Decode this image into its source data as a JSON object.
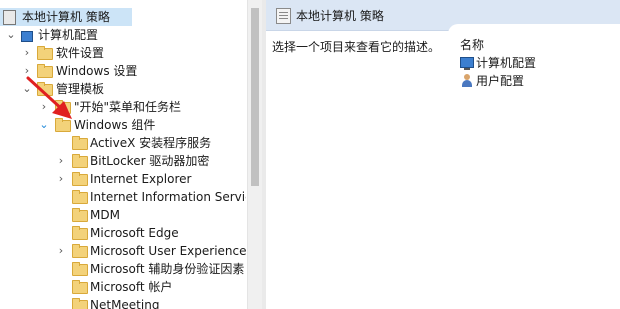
{
  "tree": {
    "root": "本地计算机 策略",
    "computer_config": "计算机配置",
    "software_settings": "软件设置",
    "windows_settings": "Windows 设置",
    "admin_templates": "管理模板",
    "start_menu": "\"开始\"菜单和任务栏",
    "windows_components": "Windows 组件",
    "children": [
      {
        "label": "ActiveX 安装程序服务",
        "expandable": false
      },
      {
        "label": "BitLocker 驱动器加密",
        "expandable": true
      },
      {
        "label": "Internet Explorer",
        "expandable": true
      },
      {
        "label": "Internet Information Services",
        "expandable": false
      },
      {
        "label": "MDM",
        "expandable": false
      },
      {
        "label": "Microsoft Edge",
        "expandable": false
      },
      {
        "label": "Microsoft User Experience Virt",
        "expandable": true
      },
      {
        "label": "Microsoft 辅助身份验证因素",
        "expandable": false
      },
      {
        "label": "Microsoft 帐户",
        "expandable": false
      },
      {
        "label": "NetMeeting",
        "expandable": false
      }
    ]
  },
  "right": {
    "header_title": "本地计算机 策略",
    "description": "选择一个项目来查看它的描述。",
    "column_name": "名称",
    "items": [
      "计算机配置",
      "用户配置"
    ]
  },
  "colors": {
    "selection": "#cce4f7",
    "header": "#dbe6f4",
    "arrow": "#e02020"
  }
}
